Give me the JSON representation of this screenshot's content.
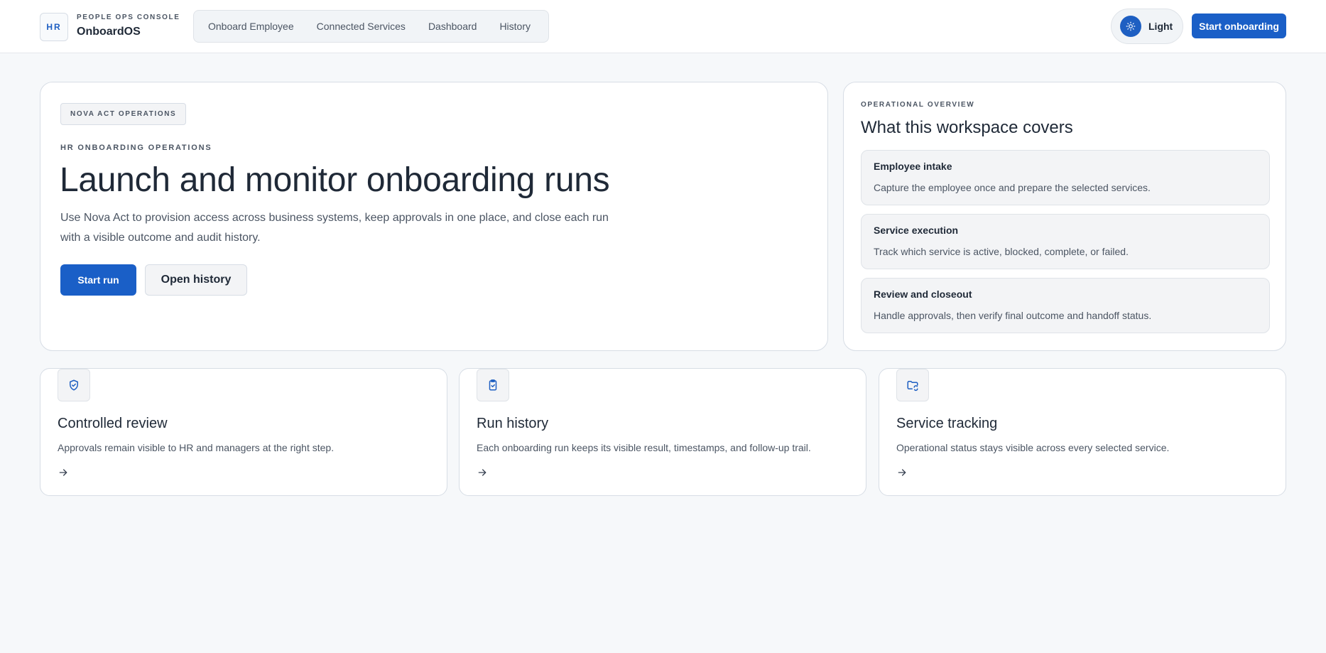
{
  "header": {
    "logo_text": "HR",
    "eyebrow": "PEOPLE OPS CONSOLE",
    "app_name": "OnboardOS",
    "nav": [
      {
        "label": "Onboard Employee"
      },
      {
        "label": "Connected Services"
      },
      {
        "label": "Dashboard"
      },
      {
        "label": "History"
      }
    ],
    "theme_label": "Light",
    "theme_icon": "sun-icon",
    "cta_label": "Start onboarding"
  },
  "hero": {
    "tag": "NOVA ACT OPERATIONS",
    "eyebrow": "HR ONBOARDING OPERATIONS",
    "title": "Launch and monitor onboarding runs",
    "description": "Use Nova Act to provision access across business systems, keep approvals in one place, and close each run with a visible outcome and audit history.",
    "primary_label": "Start run",
    "secondary_label": "Open history"
  },
  "overview": {
    "eyebrow": "OPERATIONAL OVERVIEW",
    "title": "What this workspace covers",
    "items": [
      {
        "title": "Employee intake",
        "description": "Capture the employee once and prepare the selected services."
      },
      {
        "title": "Service execution",
        "description": "Track which service is active, blocked, complete, or failed."
      },
      {
        "title": "Review and closeout",
        "description": "Handle approvals, then verify final outcome and handoff status."
      }
    ]
  },
  "features": [
    {
      "icon": "shield-check-icon",
      "title": "Controlled review",
      "description": "Approvals remain visible to HR and managers at the right step."
    },
    {
      "icon": "clipboard-check-icon",
      "title": "Run history",
      "description": "Each onboarding run keeps its visible result, timestamps, and follow-up trail."
    },
    {
      "icon": "folder-sync-icon",
      "title": "Service tracking",
      "description": "Operational status stays visible across every selected service."
    }
  ],
  "colors": {
    "accent": "#1a5fc7",
    "background": "#f6f8fa",
    "card": "#ffffff",
    "border": "#d7dde5"
  }
}
